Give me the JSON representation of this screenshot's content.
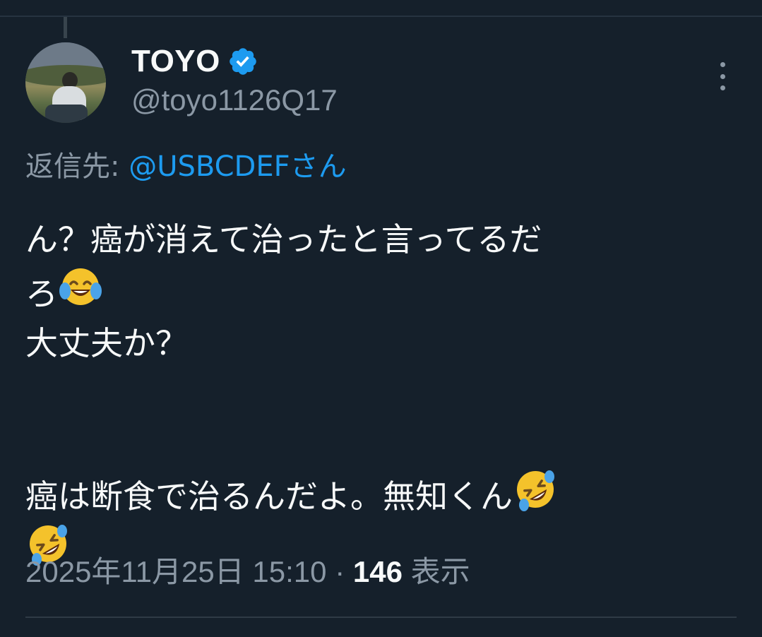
{
  "tweet": {
    "author": {
      "display_name": "TOYO",
      "handle": "@toyo1126Q17",
      "verified": true
    },
    "reply_to": {
      "label": "返信先: ",
      "target": "@USBCDEFさん"
    },
    "text": {
      "line1": "ん？癌が消えて治ったと言ってるだ",
      "line2": "ろ",
      "line3": "大丈夫か？",
      "line4": "癌は断食で治るんだよ。無知くん"
    },
    "emojis": {
      "line2": "face-with-tears-of-joy",
      "line4_end": "rolling-on-the-floor-laughing",
      "line5": "rolling-on-the-floor-laughing"
    },
    "meta": {
      "timestamp": "2025年11月25日 15:10",
      "separator": " · ",
      "view_count": "146",
      "view_label": " 表示"
    }
  },
  "icons": {
    "verified": "verified-badge-icon",
    "more": "more-options-icon"
  },
  "colors": {
    "background": "#15202b",
    "text_primary": "#f7f9f9",
    "text_secondary": "#8b98a5",
    "accent": "#1d9bf0"
  }
}
